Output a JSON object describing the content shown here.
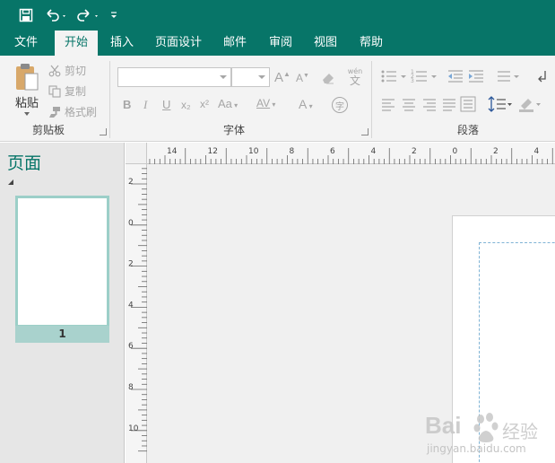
{
  "quick_access": {
    "icons": [
      "save-icon",
      "undo-icon",
      "redo-icon",
      "customize-icon"
    ]
  },
  "tabs": [
    {
      "label": "文件",
      "active": false
    },
    {
      "label": "开始",
      "active": true
    },
    {
      "label": "插入",
      "active": false
    },
    {
      "label": "页面设计",
      "active": false
    },
    {
      "label": "邮件",
      "active": false
    },
    {
      "label": "审阅",
      "active": false
    },
    {
      "label": "视图",
      "active": false
    },
    {
      "label": "帮助",
      "active": false
    }
  ],
  "ribbon": {
    "clipboard": {
      "paste_label": "粘贴",
      "cut_label": "剪切",
      "copy_label": "复制",
      "format_painter_label": "格式刷",
      "group_label": "剪贴板"
    },
    "font": {
      "font_name_value": "",
      "font_size_value": "",
      "grow_label": "A",
      "shrink_label": "A",
      "phonetic_label": "wén",
      "phonetic_char": "文",
      "bold_label": "B",
      "italic_label": "I",
      "underline_label": "U",
      "subscript_label": "x₂",
      "superscript_label": "x²",
      "char_spacing_label": "AV",
      "case_label": "Aa",
      "font_color_label": "A",
      "enclosed_char_label": "字",
      "group_label": "字体"
    },
    "paragraph": {
      "group_label": "段落"
    }
  },
  "pages_panel": {
    "title": "页面",
    "page_number": "1"
  },
  "rulers": {
    "horizontal_labels": [
      "14",
      "12",
      "10",
      "8",
      "6",
      "4",
      "2",
      "0",
      "2",
      "4"
    ],
    "vertical_labels": [
      "2",
      "0",
      "2",
      "4",
      "6",
      "8",
      "10"
    ]
  },
  "watermark": {
    "brand": "Bai",
    "brand_cn": "经验",
    "url": "jingyan.baidu.com"
  },
  "colors": {
    "accent": "#077568",
    "ribbon_bg": "#f3f3f3",
    "thumb_border": "#9ccfc8",
    "thumb_label_bg": "#a9d2cd"
  }
}
